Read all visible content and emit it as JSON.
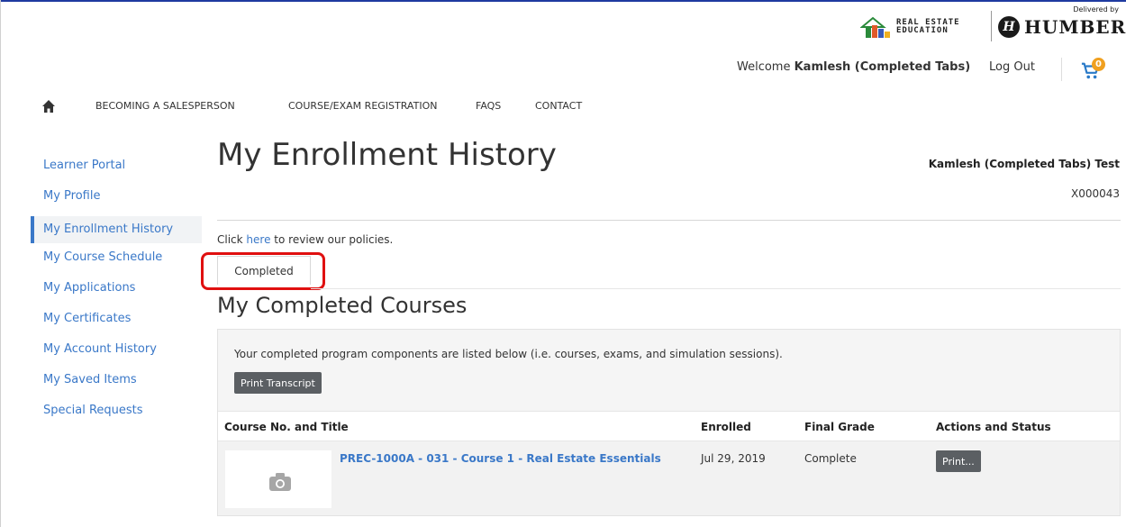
{
  "branding": {
    "ree_logo_text": "REAL ESTATE\nEDUCATION",
    "delivered_by": "Delivered by",
    "humber_badge": "H",
    "humber_text": "HUMBER"
  },
  "header": {
    "welcome_prefix": "Welcome",
    "user": "Kamlesh (Completed Tabs)",
    "logout_label": "Log Out",
    "cart_count": "0"
  },
  "nav": {
    "items": [
      {
        "label": "BECOMING A SALESPERSON"
      },
      {
        "label": "COURSE/EXAM REGISTRATION"
      },
      {
        "label": "FAQS"
      },
      {
        "label": "CONTACT"
      }
    ]
  },
  "sidebar": {
    "items": [
      {
        "label": "Learner Portal"
      },
      {
        "label": "My Profile"
      },
      {
        "label": "My Enrollment History"
      },
      {
        "label": "My Course Schedule"
      },
      {
        "label": "My Applications"
      },
      {
        "label": "My Certificates"
      },
      {
        "label": "My Account History"
      },
      {
        "label": "My Saved Items"
      },
      {
        "label": "Special Requests"
      }
    ],
    "active_index": 2
  },
  "main": {
    "title": "My Enrollment History",
    "user_full_name": "Kamlesh (Completed Tabs) Test",
    "user_id": "X000043",
    "policy_prefix": "Click",
    "policy_link": "here",
    "policy_suffix": "to review our policies.",
    "tab_label": "Completed",
    "section_title": "My Completed Courses",
    "description": "Your completed program components are listed below (i.e. courses, exams, and simulation sessions).",
    "print_transcript_label": "Print Transcript",
    "table": {
      "columns": [
        "Course No. and Title",
        "Enrolled",
        "Final Grade",
        "Actions and Status"
      ],
      "rows": [
        {
          "course": "PREC-1000A - 031 - Course 1 - Real Estate Essentials",
          "enrolled": "Jul 29, 2019",
          "grade": "Complete",
          "action": "Print..."
        }
      ]
    }
  },
  "colors": {
    "link": "#3a78c8",
    "button": "#5b5f63",
    "highlight": "#e01010",
    "cart_badge": "#f0a020"
  }
}
